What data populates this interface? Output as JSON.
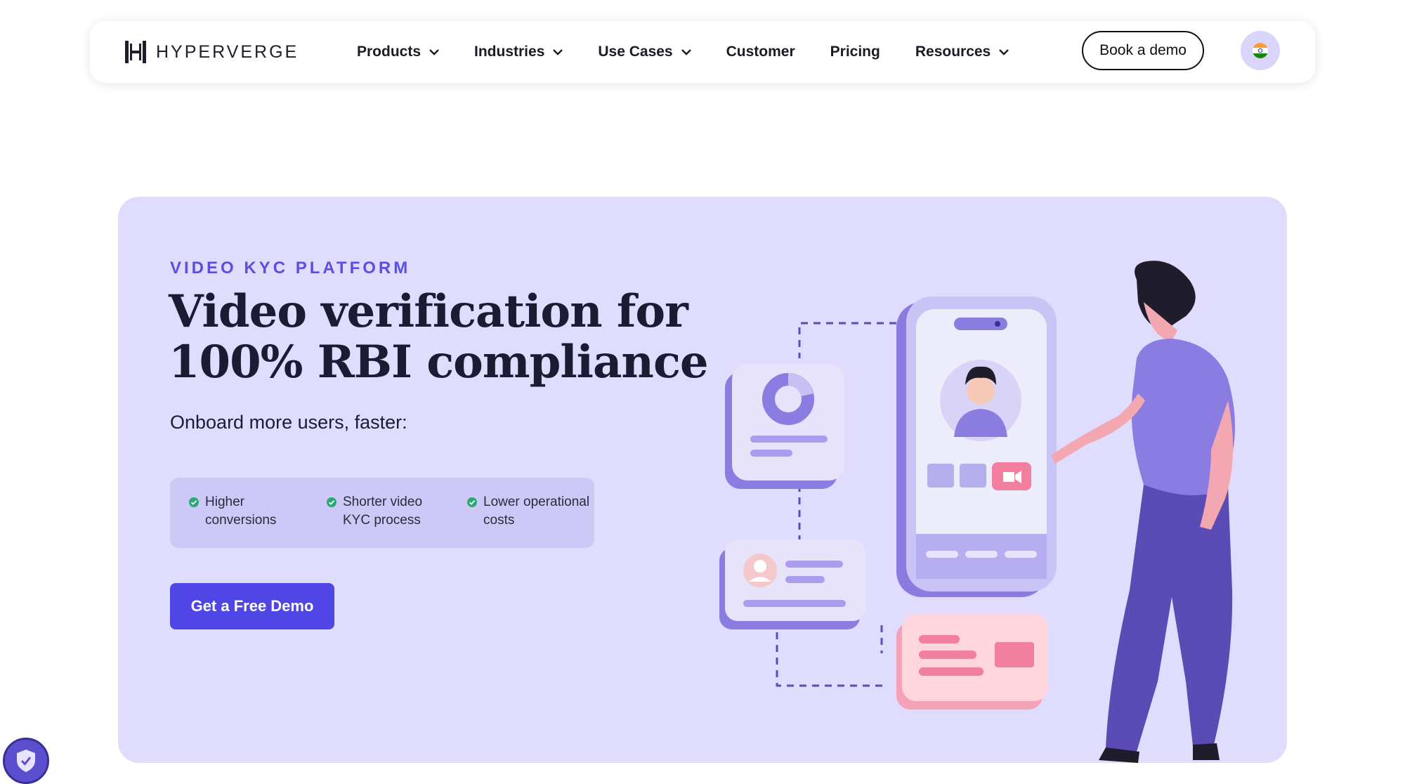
{
  "nav": {
    "logo_text": "HYPERVERGE",
    "items": [
      {
        "label": "Products",
        "has_dropdown": true
      },
      {
        "label": "Industries",
        "has_dropdown": true
      },
      {
        "label": "Use Cases",
        "has_dropdown": true
      },
      {
        "label": "Customer",
        "has_dropdown": false
      },
      {
        "label": "Pricing",
        "has_dropdown": false
      },
      {
        "label": "Resources",
        "has_dropdown": true
      }
    ],
    "book_demo_label": "Book a demo",
    "region_icon": "india-flag-icon"
  },
  "hero": {
    "eyebrow": "VIDEO KYC PLATFORM",
    "headline_line1": "Video verification for",
    "headline_line2": "100% RBI compliance",
    "subhead": "Onboard more users, faster:",
    "benefits": [
      {
        "line1": "Higher",
        "line2": "conversions"
      },
      {
        "line1": "Shorter video",
        "line2": "KYC process"
      },
      {
        "line1": "Lower operational",
        "line2": "costs"
      }
    ],
    "cta_label": "Get a Free Demo"
  },
  "colors": {
    "hero_bg": "#dfdcfd",
    "accent": "#5046e5",
    "eyebrow": "#5b4fe0",
    "check": "#2aa876",
    "pill_bg": "#cdc9f6"
  }
}
